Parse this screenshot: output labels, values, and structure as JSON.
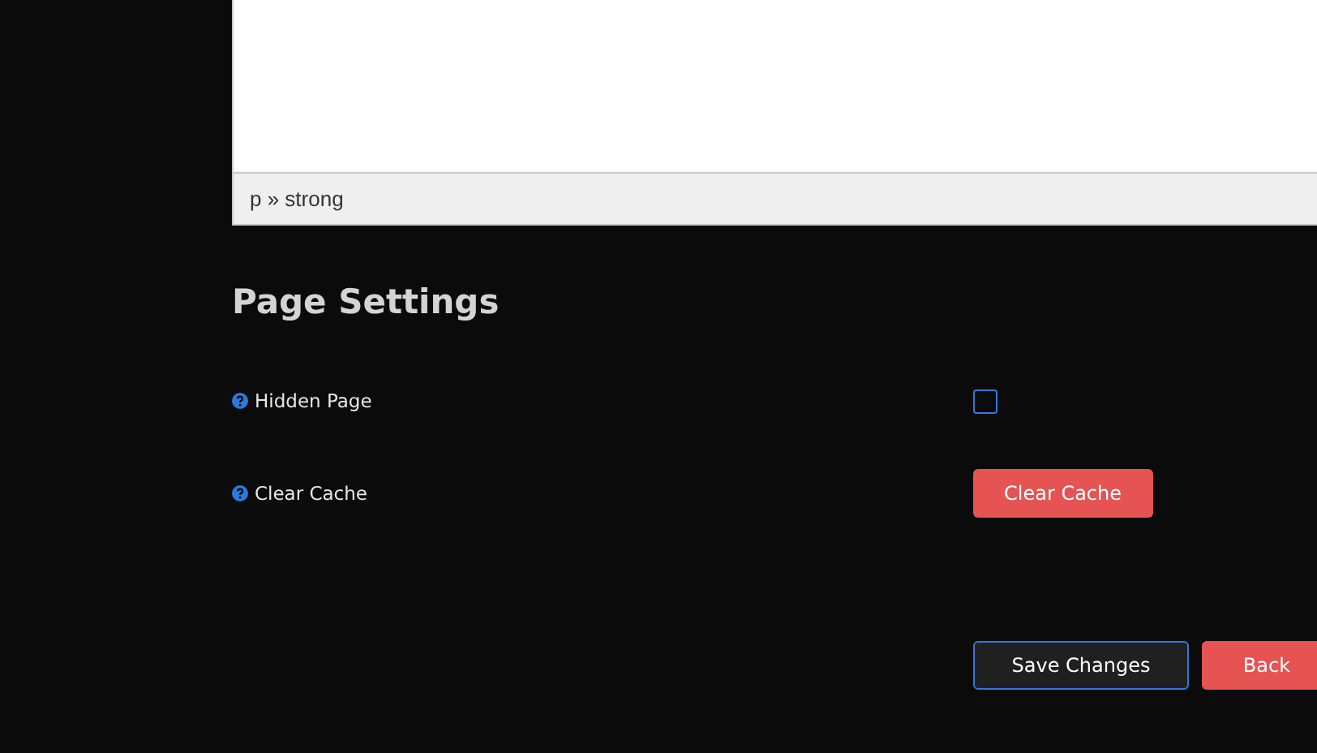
{
  "editor": {
    "status_path": "p » strong"
  },
  "page_settings": {
    "title": "Page Settings",
    "rows": [
      {
        "label": "Hidden Page",
        "kind": "checkbox",
        "checked": false
      },
      {
        "label": "Clear Cache",
        "kind": "button",
        "button_label": "Clear Cache"
      }
    ]
  },
  "buttons": [
    {
      "label": "Save Changes",
      "kind": "primary"
    },
    {
      "label": "Back",
      "kind": "danger"
    }
  ]
}
